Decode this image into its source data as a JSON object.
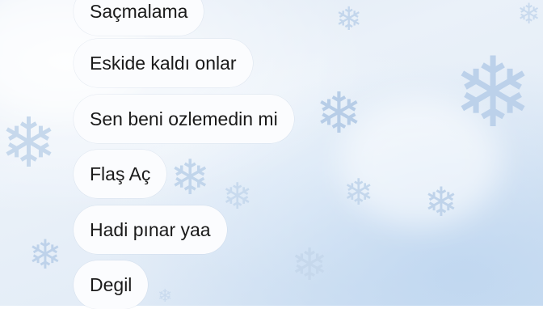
{
  "conversation": {
    "messages": [
      {
        "text": "Saçmalama"
      },
      {
        "text": "Eskide kaldı onlar"
      },
      {
        "text": "Sen beni ozlemedin mi"
      },
      {
        "text": "Flaş Aç"
      },
      {
        "text": "Hadi pınar yaa"
      },
      {
        "text": "Degil"
      }
    ]
  },
  "theme": {
    "background": "#e6eef8",
    "bubble_color": "#fbfcfe",
    "text_color": "#1a1a1a",
    "wallpaper_icon": "snowflake-icon"
  }
}
